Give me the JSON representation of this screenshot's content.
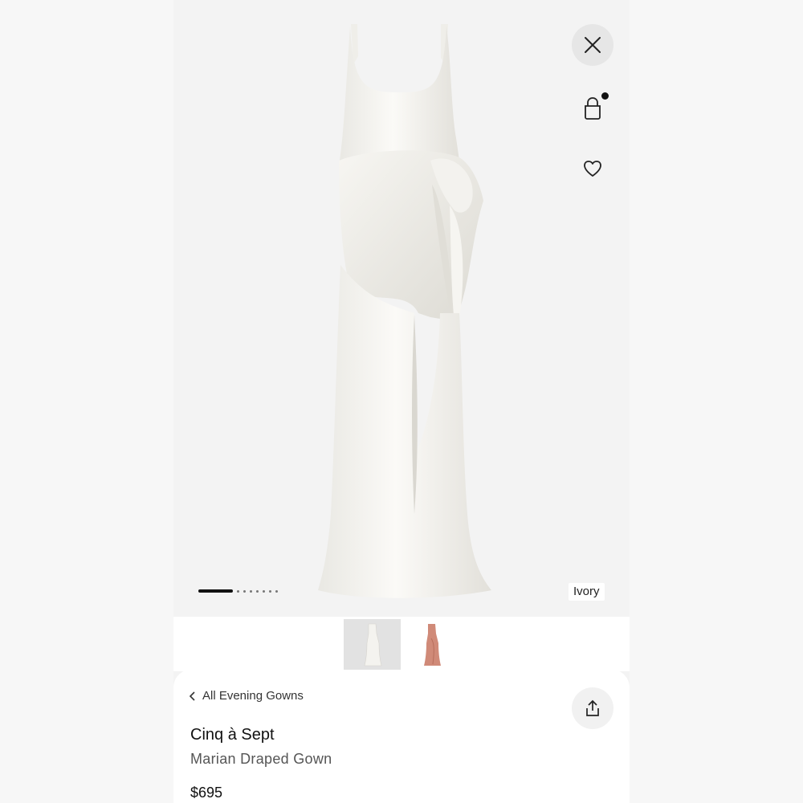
{
  "hero": {
    "color_label": "Ivory",
    "carousel_total": 8,
    "carousel_active": 1
  },
  "icons": {
    "close": "close-icon",
    "bag": "shopping-bag-icon",
    "heart": "heart-icon",
    "share": "share-icon",
    "back": "chevron-left-icon"
  },
  "thumbnails": [
    {
      "color": "Ivory",
      "swatch": "#f0eee9"
    },
    {
      "color": "Rose",
      "swatch": "#d08a78"
    }
  ],
  "product": {
    "breadcrumb": "All Evening Gowns",
    "brand": "Cinq à Sept",
    "name": "Marian Draped Gown",
    "price": "$695"
  },
  "colors": {
    "accent": "#111111",
    "hero_bg": "#f3f3f3"
  }
}
